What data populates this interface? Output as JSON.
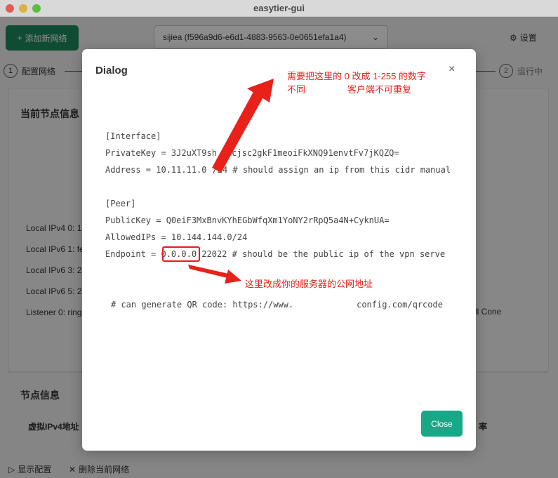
{
  "window": {
    "title": "easytier-gui"
  },
  "toolbar": {
    "add_network_label": "添加新网络",
    "network_select_value": "sijiea (f596a9d6-e6d1-4883-9563-0e0651efa1a4)",
    "settings_label": "设置"
  },
  "steps": [
    {
      "number": "1",
      "label": "配置网络"
    },
    {
      "number": "2",
      "label": "运行中"
    }
  ],
  "node_info": {
    "title": "当前节点信息",
    "rows": [
      "Local IPv4 0: 1",
      "Local IPv6 1: fe",
      "Local IPv6 3: 2",
      "Local IPv6 5: 2",
      "Listener 0: ring"
    ],
    "nat_partial": "ll Cone"
  },
  "peers_section": {
    "title": "节点信息",
    "col_ipv4": "虚拟IPv4地址",
    "col_right": "率"
  },
  "bottom_bar": {
    "show_config": "显示配置",
    "delete_network": "删除当前网络"
  },
  "dialog": {
    "title": "Dialog",
    "close_icon": "×",
    "lines": [
      "[Interface]",
      "PrivateKey = 3J2uXT9sh",
      "Gcjsc2gkF1meoiFkXNQ91envtFv7jKQZQ=",
      "Address = 10.11.11.0",
      "/24 # should assign an ip from this cidr manual",
      "[Peer]",
      "PublicKey = Q0eiF3MxBnvKYhEGbWfqXm1YoNY2rRpQ5a4N+CyknUA=",
      "AllowedIPs = 10.144.144.0/24",
      "Endpoint = ",
      "0.0.0.0",
      ":22022 # should be the public ip of the vpn serve",
      "# can generate QR code: https://www.",
      "config.com/qrcode"
    ],
    "close_button": "Close"
  },
  "annotations": {
    "note1_line1": "需要把这里的 0 改成 1-255 的数字",
    "note1_line2a": "不同",
    "note1_line2b": "客户端不可重复",
    "note2": "这里改成你的服务器的公网地址",
    "color": "#e8211b"
  },
  "colors": {
    "primary_green": "#1e8a5f",
    "close_button": "#17a887"
  }
}
